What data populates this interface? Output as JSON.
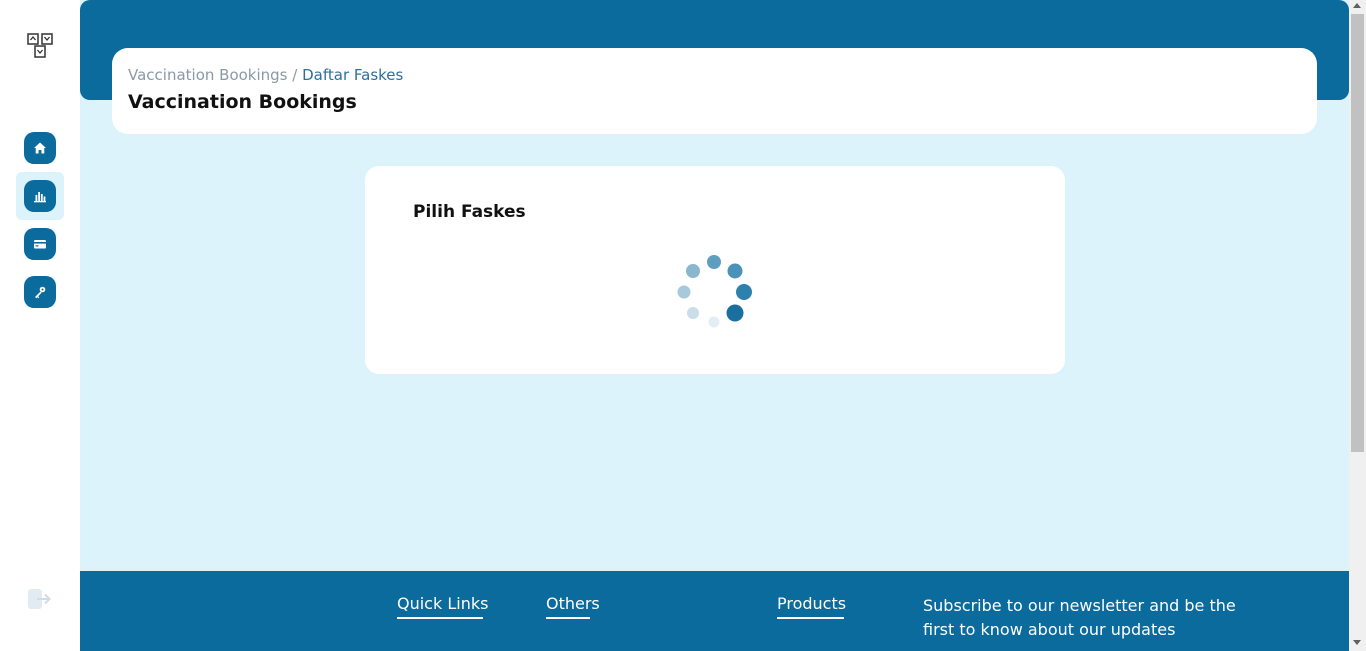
{
  "sidebar": {
    "logo": "logo-icon",
    "items": [
      {
        "icon": "home-icon",
        "active": false
      },
      {
        "icon": "bar-chart-icon",
        "active": true
      },
      {
        "icon": "card-icon",
        "active": false
      },
      {
        "icon": "key-icon",
        "active": false
      }
    ],
    "logout_icon": "logout-icon"
  },
  "header": {
    "breadcrumb": [
      "Vaccination Bookings",
      "Daftar Faskes"
    ],
    "breadcrumb_separator": "/",
    "title": "Vaccination Bookings"
  },
  "card": {
    "title": "Pilih Faskes",
    "loading": true
  },
  "footer": {
    "links": [
      "Quick Links",
      "Others",
      "Products"
    ],
    "newsletter": "Subscribe to our newsletter and be the first to know about our updates"
  },
  "colors": {
    "primary": "#0b6b9c",
    "background": "#dcf3fb",
    "breadcrumb_muted": "#8a99a8",
    "breadcrumb_active": "#2f6f9a"
  }
}
